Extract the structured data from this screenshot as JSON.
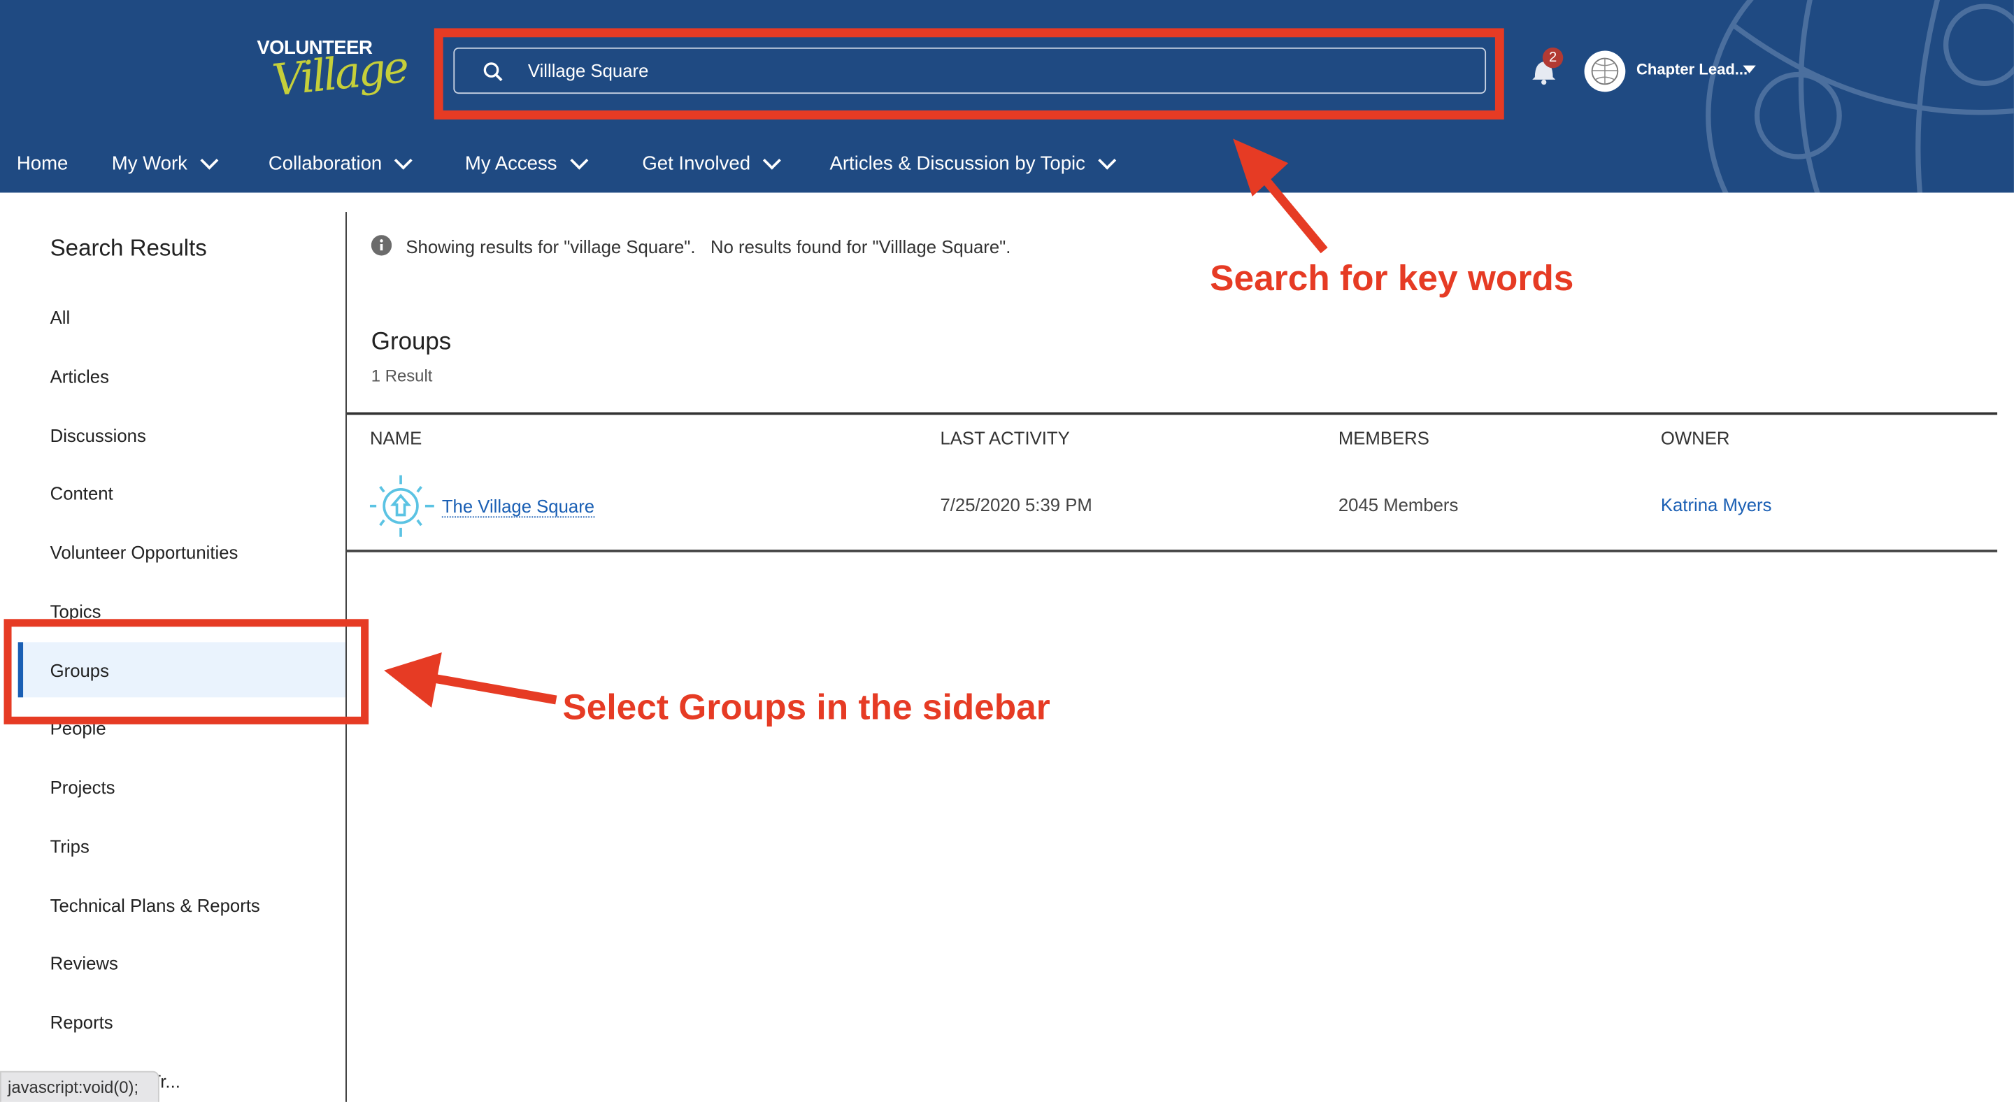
{
  "header": {
    "logo": {
      "line1": "VOLUNTEER",
      "line2": "Village"
    },
    "search": {
      "value": "Villlage Square"
    },
    "notifications": {
      "count": "2"
    },
    "user": {
      "name": "Chapter Lead..."
    }
  },
  "nav": [
    "Home",
    "My Work",
    "Collaboration",
    "My Access",
    "Get Involved",
    "Articles & Discussion by Topic"
  ],
  "sidebar": {
    "title": "Search Results",
    "items": [
      "All",
      "Articles",
      "Discussions",
      "Content",
      "Volunteer Opportunities",
      "Topics",
      "Groups",
      "People",
      "Projects",
      "Trips",
      "Technical Plans & Reports",
      "Reviews",
      "Reports",
      "Certification/Tr..."
    ],
    "selected": "Groups"
  },
  "main": {
    "info": "Showing results for \"village Square\".   No results found for \"Villlage Square\".",
    "section_title": "Groups",
    "result_count": "1 Result",
    "columns": [
      "NAME",
      "LAST ACTIVITY",
      "MEMBERS",
      "OWNER"
    ],
    "rows": [
      {
        "name": "The Village Square",
        "last_activity": "7/25/2020 5:39 PM",
        "members": "2045 Members",
        "owner": "Katrina Myers"
      }
    ]
  },
  "annotations": {
    "search": "Search for key words",
    "groups": "Select Groups in the sidebar"
  },
  "status_tooltip": "javascript:void(0);",
  "colors": {
    "header": "#1f4a82",
    "annotation": "#e63b24",
    "link": "#1a5fb4",
    "selected_bg": "#eaf3fd",
    "group_icon": "#5bc3e3"
  }
}
